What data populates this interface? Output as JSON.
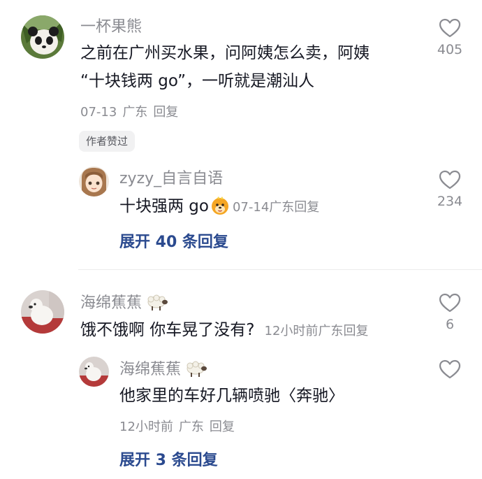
{
  "comments": [
    {
      "username": "一杯果熊",
      "text_line1": "之前在广州买水果，问阿姨怎么卖，阿姨",
      "text_line2": "“十块钱两 go”，一听就是潮汕人",
      "date": "07-13",
      "location": "广东",
      "reply_label": "回复",
      "likes": "405",
      "author_badge": "作者赞过",
      "avatar_icon": "panda-avatar"
    },
    {
      "username": "zyzy_自言自语",
      "text": "十块强两 go",
      "date": "07-14",
      "location": "广东",
      "reply_label": "回复",
      "likes": "234",
      "avatar_icon": "anime-girl-avatar"
    },
    {
      "username": "海绵蕉蕉",
      "text": "饿不饿啊 你车晃了没有?",
      "date": "12小时前",
      "location": "广东",
      "reply_label": "回复",
      "likes": "6",
      "avatar_icon": "dog-avatar"
    },
    {
      "username": "海绵蕉蕉",
      "text": "他家里的车好几辆喷驰〈奔驰〉",
      "date": "12小时前",
      "location": "广东",
      "reply_label": "回复",
      "likes": "",
      "avatar_icon": "dog-avatar"
    }
  ],
  "expand": [
    {
      "label": "展开 40 条回复"
    },
    {
      "label": "展开 3 条回复"
    }
  ],
  "colors": {
    "secondary_text": "#8a8b91",
    "expand_link": "#2b4a8f"
  }
}
